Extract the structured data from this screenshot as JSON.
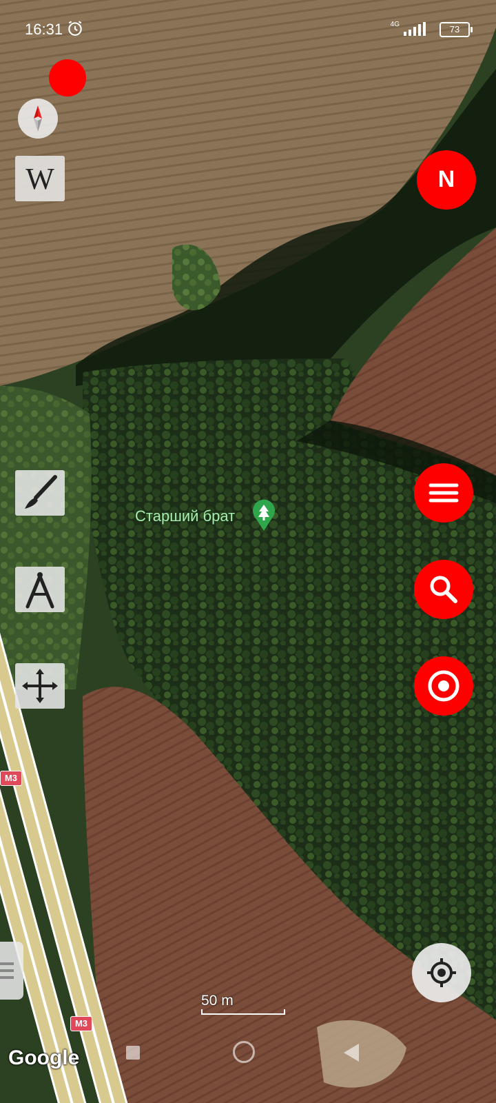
{
  "status_bar": {
    "time": "16:31",
    "alarm_icon": "alarm-clock-icon",
    "network": "4G",
    "signal_icon": "signal-bars-icon",
    "battery": "73"
  },
  "map": {
    "provider": "Google",
    "poi": {
      "label": "Старший брат",
      "icon": "forest-pin-icon"
    },
    "road_shields": [
      "M3",
      "M3"
    ],
    "scale_label": "50 m"
  },
  "left_toolbar": {
    "recording_dot": "red-dot",
    "compass_icon": "compass-icon",
    "wikipedia_label": "W",
    "draw_icon": "paintbrush-icon",
    "measure_icon": "compass-divider-icon",
    "move_icon": "move-arrows-icon"
  },
  "right_toolbar": {
    "north_label": "N",
    "menu_icon": "hamburger-menu-icon",
    "search_icon": "search-icon",
    "target_icon": "target-icon",
    "locate_icon": "gps-locate-icon"
  },
  "colors": {
    "accent": "#ff0000",
    "button_gray": "#e6e6e6",
    "poi_label": "#a8ecb0",
    "road_shield": "#e0495a"
  }
}
